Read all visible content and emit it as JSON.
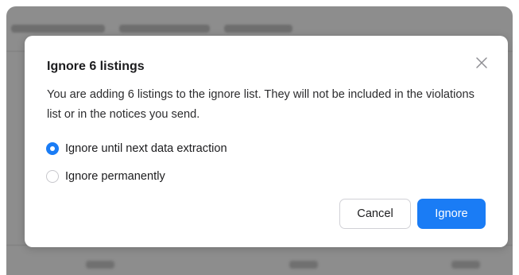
{
  "dialog": {
    "title": "Ignore 6 listings",
    "description": "You are adding 6 listings to the ignore list. They will not be included in the violations list or in the notices you send.",
    "close_icon": "close-icon",
    "options": [
      {
        "label": "Ignore until next data extraction",
        "selected": true
      },
      {
        "label": "Ignore permanently",
        "selected": false
      }
    ],
    "cancel_label": "Cancel",
    "confirm_label": "Ignore"
  },
  "colors": {
    "accent": "#1a7cf5",
    "overlay": "#8d8d8d",
    "dialog_bg": "#ffffff",
    "text": "#1c1c1e"
  }
}
